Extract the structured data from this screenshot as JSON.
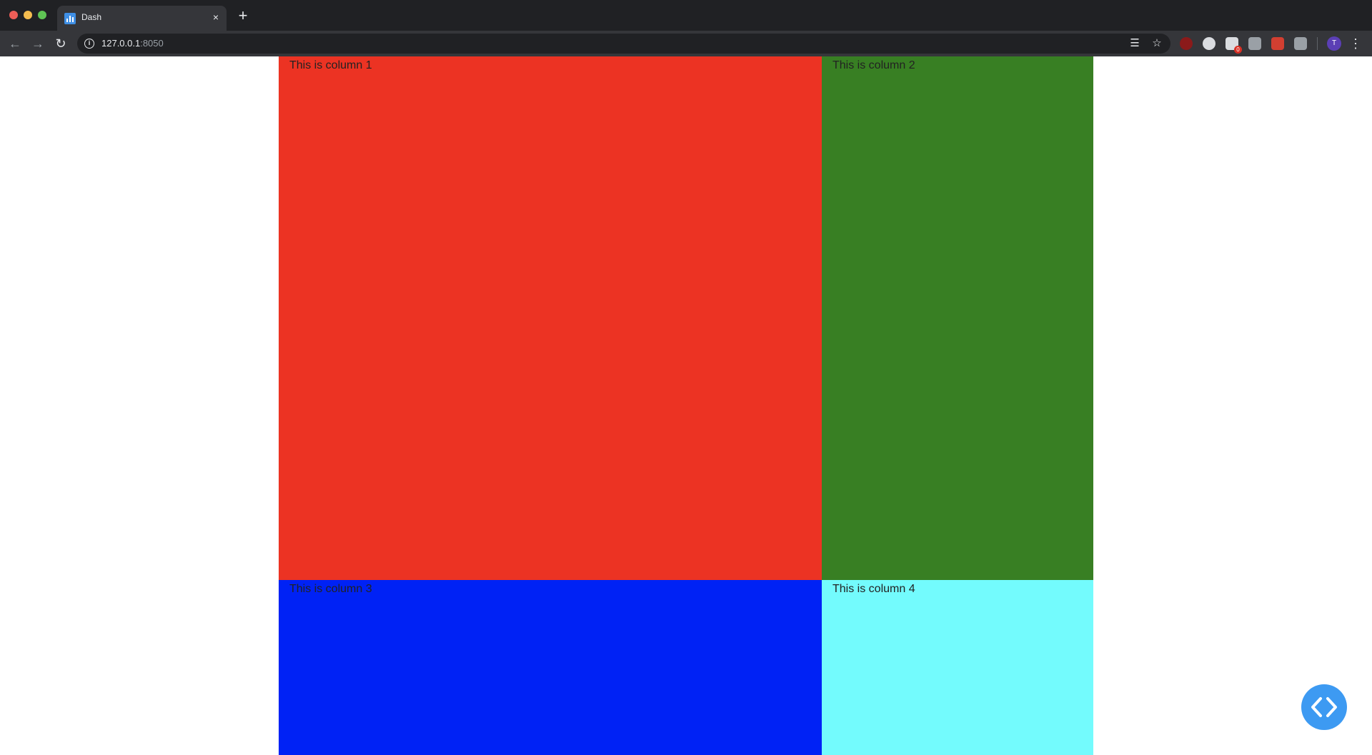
{
  "browser": {
    "tab": {
      "title": "Dash",
      "favicon": "dash-chart-icon",
      "close_glyph": "×"
    },
    "new_tab_glyph": "+",
    "nav": {
      "back_glyph": "←",
      "forward_glyph": "→",
      "reload_glyph": "↻"
    },
    "address": {
      "host": "127.0.0.1",
      "port": ":8050",
      "info_glyph": "i"
    },
    "omnibox_icons": {
      "reader_glyph": "☰",
      "star_glyph": "☆"
    },
    "extensions": [
      {
        "name": "ublock-icon"
      },
      {
        "name": "extension-b-icon"
      },
      {
        "name": "extension-c-icon",
        "badge": "0"
      },
      {
        "name": "screenshot-icon"
      },
      {
        "name": "extension-e-icon"
      },
      {
        "name": "pocket-icon"
      }
    ],
    "profile_initial": "T",
    "menu_glyph": "⋮"
  },
  "layout": {
    "columns": [
      {
        "label": "This is column 1",
        "color": "#ec3323"
      },
      {
        "label": "This is column 2",
        "color": "#387f23"
      },
      {
        "label": "This is column 3",
        "color": "#0022f5"
      },
      {
        "label": "This is column 4",
        "color": "#73fbfd"
      }
    ]
  },
  "devtools": {
    "icon": "code-brackets-icon",
    "color": "#3d9af2"
  }
}
